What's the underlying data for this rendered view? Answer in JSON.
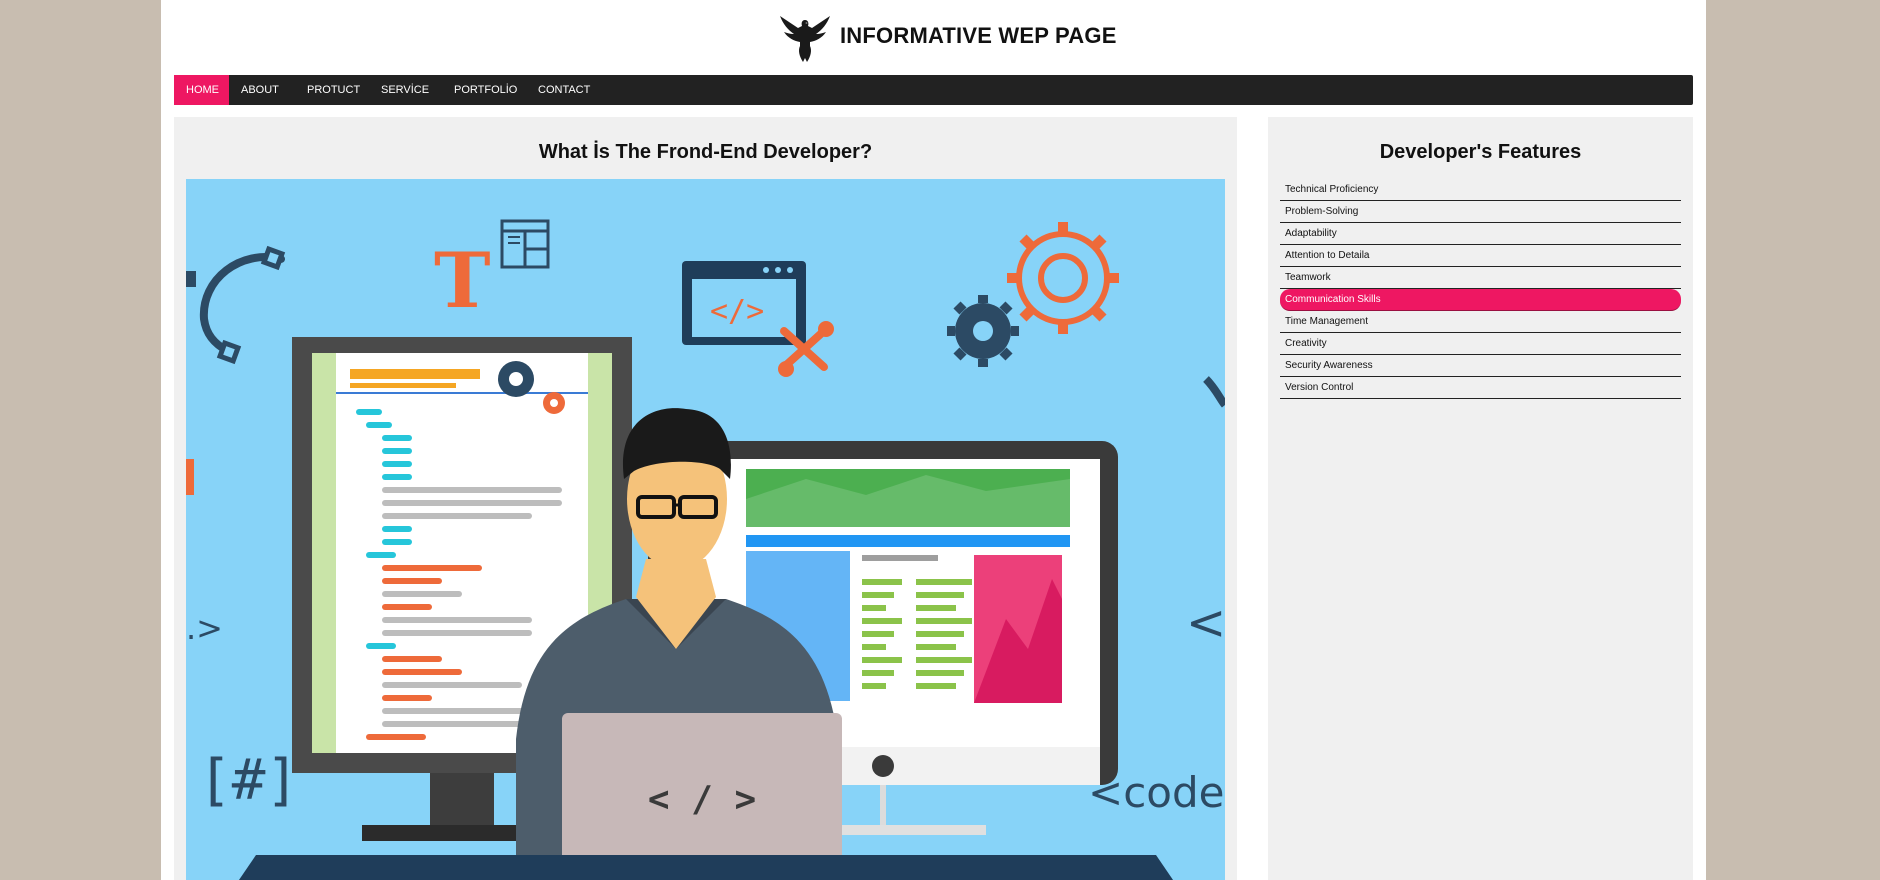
{
  "header": {
    "title": "INFORMATIVE WEP PAGE"
  },
  "nav": {
    "items": [
      {
        "label": "HOME",
        "active": true
      },
      {
        "label": "ABOUT"
      },
      {
        "label": "PROTUCT"
      },
      {
        "label": "SERVİCE"
      },
      {
        "label": "PORTFOLİO"
      },
      {
        "label": "CONTACT"
      }
    ]
  },
  "main": {
    "title": "What İs The Frond-End Developer?",
    "hero": {
      "texts": {
        "t_letter": "T",
        "code_tag": "</>",
        "hash": "[#]",
        "code_word": "<code>",
        "laptop_tag": "< / >",
        "left_frag": ".>",
        "right_frag": "<"
      }
    }
  },
  "sidebar": {
    "title": "Developer's Features",
    "items": [
      "Technical Proficiency",
      "Problem-Solving",
      "Adaptability",
      "Attention to Detaila",
      "Teamwork",
      "Communication Skills",
      "Time Management",
      "Creativity",
      "Security Awareness",
      "Version Control"
    ],
    "active_index": 5
  },
  "colors": {
    "accent": "#ee1762",
    "nav_bg": "#222222",
    "panel_bg": "#f0f0f0",
    "outer_bg": "#c8bdb0",
    "hero_bg": "#87d3f8"
  },
  "icons": {
    "logo": "eagle-logo-icon"
  }
}
